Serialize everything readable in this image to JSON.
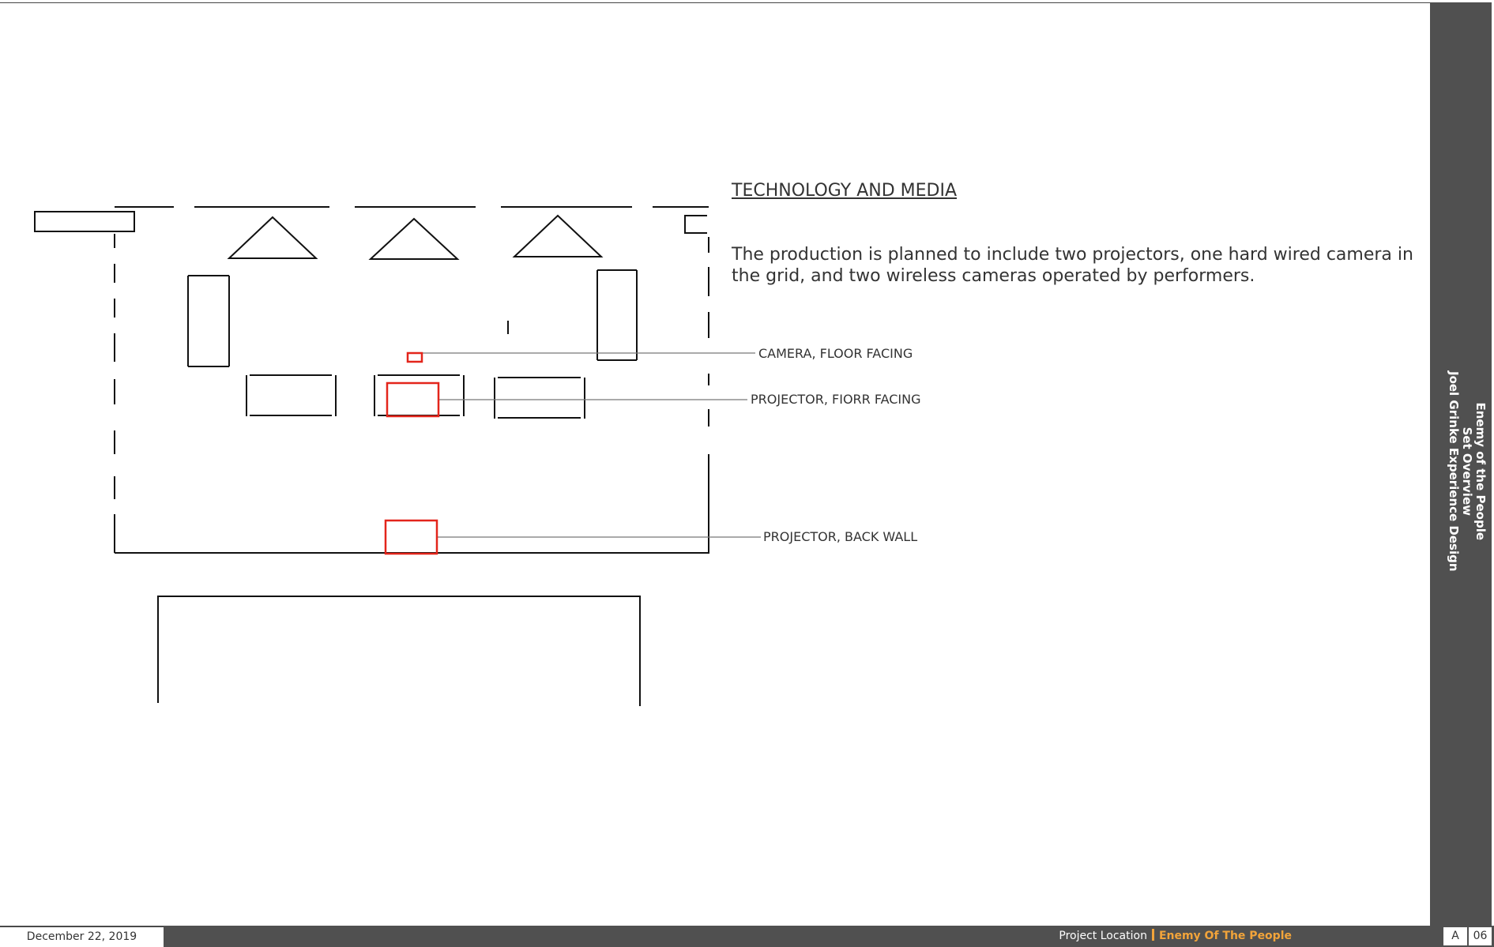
{
  "section": {
    "heading": "TECHNOLOGY AND MEDIA",
    "description": "The production is planned to include two projectors, one hard wired camera in the grid, and two wireless cameras operated by performers."
  },
  "callouts": {
    "camera": "CAMERA, FLOOR FACING",
    "projector_floor": "PROJECTOR, FIORR FACING",
    "projector_back": "PROJECTOR, BACK WALL"
  },
  "sidebar": {
    "line1": "Enemy of the People",
    "line2": "Set Overview",
    "line3": "Joel Grinke Experience Design"
  },
  "footer": {
    "date": "December 22, 2019",
    "location_label": "Project Location",
    "project_name": "Enemy Of The People",
    "sheet_letter": "A",
    "sheet_number": "06"
  },
  "colors": {
    "equipment": "#e3251b",
    "accent": "#f2a43a",
    "sidebar": "#505050"
  }
}
